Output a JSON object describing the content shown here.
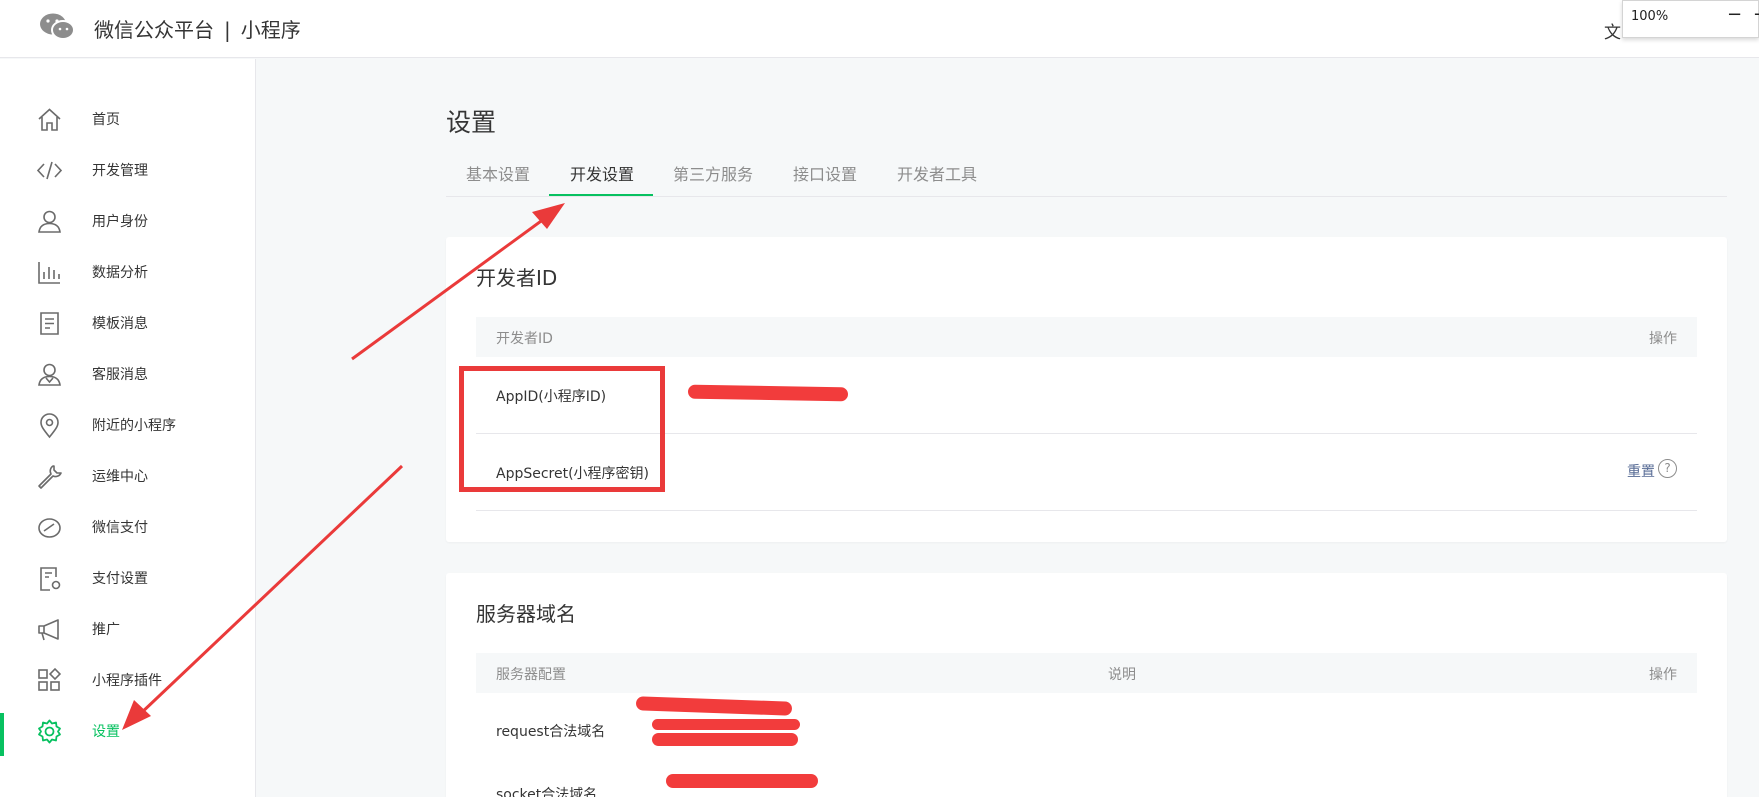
{
  "header": {
    "brand": "微信公众平台",
    "separator": "|",
    "product": "小程序",
    "doc_link": "文",
    "zoom": {
      "value": "100%",
      "minus": "−",
      "plus": "+"
    }
  },
  "sidebar": {
    "items": [
      {
        "label": "首页",
        "icon": "home-icon"
      },
      {
        "label": "开发管理",
        "icon": "code-icon"
      },
      {
        "label": "用户身份",
        "icon": "user-icon"
      },
      {
        "label": "数据分析",
        "icon": "bar-chart-icon"
      },
      {
        "label": "模板消息",
        "icon": "document-icon"
      },
      {
        "label": "客服消息",
        "icon": "support-user-icon"
      },
      {
        "label": "附近的小程序",
        "icon": "location-pin-icon"
      },
      {
        "label": "运维中心",
        "icon": "wrench-icon"
      },
      {
        "label": "微信支付",
        "icon": "speedometer-icon"
      },
      {
        "label": "支付设置",
        "icon": "payment-settings-icon"
      },
      {
        "label": "推广",
        "icon": "megaphone-icon"
      },
      {
        "label": "小程序插件",
        "icon": "plugin-grid-icon"
      },
      {
        "label": "设置",
        "icon": "gear-icon",
        "active": true
      }
    ]
  },
  "main": {
    "title": "设置",
    "tabs": [
      {
        "label": "基本设置"
      },
      {
        "label": "开发设置",
        "active": true
      },
      {
        "label": "第三方服务"
      },
      {
        "label": "接口设置"
      },
      {
        "label": "开发者工具"
      }
    ],
    "developer_id": {
      "title": "开发者ID",
      "columns": {
        "name": "开发者ID",
        "action": "操作"
      },
      "rows": [
        {
          "label": "AppID(小程序ID)"
        },
        {
          "label": "AppSecret(小程序密钥)",
          "action": "重置",
          "help": "?"
        }
      ]
    },
    "server_domain": {
      "title": "服务器域名",
      "columns": {
        "config": "服务器配置",
        "desc": "说明",
        "action": "操作"
      },
      "rows": [
        {
          "label": "request合法域名"
        },
        {
          "label": "socket合法域名"
        }
      ]
    }
  },
  "colors": {
    "accent": "#07c160",
    "annotation": "#ea3a3a",
    "link": "#576b95"
  }
}
